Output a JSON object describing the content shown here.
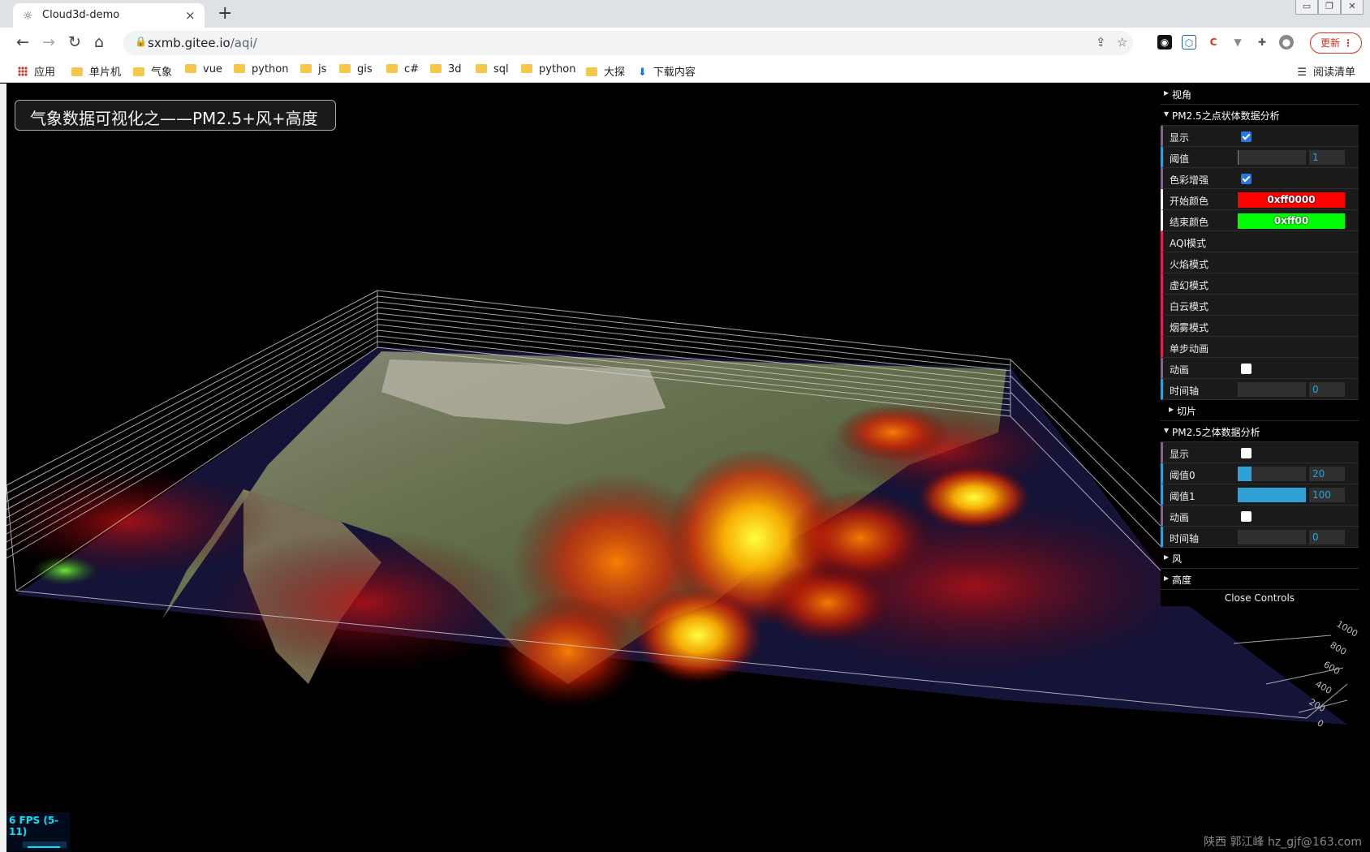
{
  "browser": {
    "tab_title": "Cloud3d-demo",
    "tab_close": "×",
    "new_tab": "+",
    "window_controls": [
      "▭",
      "❐",
      "✕"
    ],
    "url_host": "sxmb.gitee.io",
    "url_path": "/aqi/",
    "update_label": "更新",
    "bookmarks": [
      "应用",
      "单片机",
      "气象",
      "vue",
      "python",
      "js",
      "gis",
      "c#",
      "3d",
      "sql",
      "python",
      "大探",
      "下载内容"
    ],
    "reading_list": "阅读清单"
  },
  "scene": {
    "title": "气象数据可视化之——PM2.5+风+高度",
    "fps": "6 FPS (5-11)",
    "credit": "陕西 郭江峰 hz_gjf@163.com",
    "axis_ticks": [
      "1000",
      "800",
      "600",
      "400",
      "200",
      "0"
    ]
  },
  "gui": {
    "folder_view": "视角",
    "folder_points": "PM2.5之点状体数据分析",
    "points": {
      "show_label": "显示",
      "show": true,
      "threshold_label": "阈值",
      "threshold": "1",
      "threshold_fraction": 0.01,
      "enhance_label": "色彩增强",
      "enhance": true,
      "start_color_label": "开始颜色",
      "start_color": "0xff0000",
      "start_color_hex": "#ff0000",
      "end_color_label": "结束颜色",
      "end_color": "0xff00",
      "end_color_hex": "#00ff00",
      "modes": [
        "AQI模式",
        "火焰模式",
        "虚幻模式",
        "白云模式",
        "烟雾模式",
        "单步动画"
      ],
      "anim_label": "动画",
      "anim": false,
      "time_label": "时间轴",
      "time": "0"
    },
    "folder_slice": "切片",
    "folder_volume": "PM2.5之体数据分析",
    "volume": {
      "show_label": "显示",
      "show": false,
      "threshold0_label": "阈值0",
      "threshold0": "20",
      "threshold0_fraction": 0.2,
      "threshold1_label": "阈值1",
      "threshold1": "100",
      "threshold1_fraction": 1.0,
      "anim_label": "动画",
      "anim": false,
      "time_label": "时间轴",
      "time": "0"
    },
    "folder_wind": "风",
    "folder_height": "高度",
    "close_label": "Close Controls"
  }
}
